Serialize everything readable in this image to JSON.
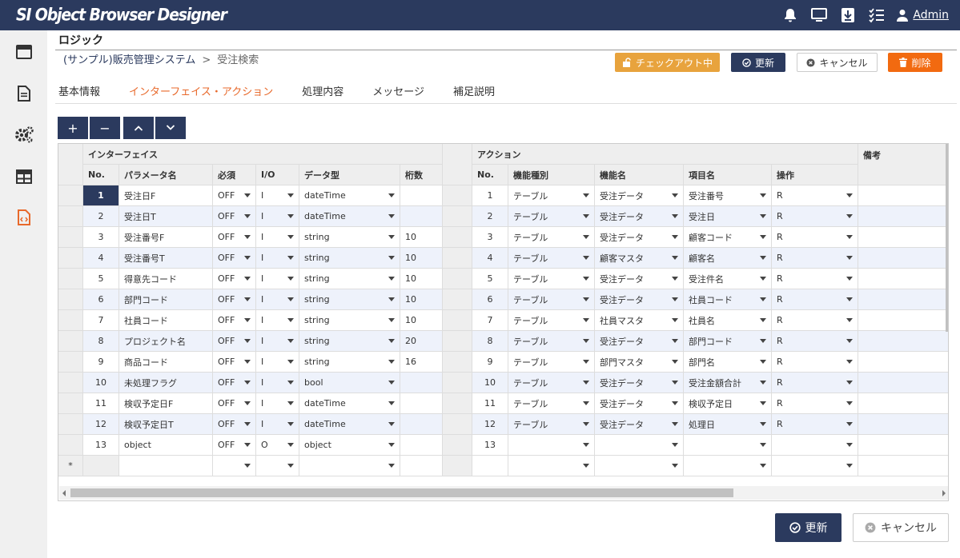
{
  "app": {
    "title": "SI Object Browser Designer"
  },
  "header": {
    "user_label": "Admin"
  },
  "page": {
    "title": "ロジック",
    "breadcrumb": {
      "system": "(サンプル)販売管理システム",
      "separator": ">",
      "current": "受注検索"
    }
  },
  "actions": {
    "checkout": "チェックアウト中",
    "update": "更新",
    "cancel": "キャンセル",
    "delete": "削除"
  },
  "tabs": [
    "基本情報",
    "インターフェイス・アクション",
    "処理内容",
    "メッセージ",
    "補足説明"
  ],
  "toolbar": {
    "add": "+",
    "remove": "−"
  },
  "grid": {
    "group_interface": "インターフェイス",
    "group_action": "アクション",
    "group_notes": "備考",
    "if_columns": [
      "No.",
      "パラメータ名",
      "必須",
      "I/O",
      "データ型",
      "桁数"
    ],
    "act_columns": [
      "No.",
      "機能種別",
      "機能名",
      "項目名",
      "操作"
    ],
    "new_row_marker": "*",
    "rows": [
      {
        "no": "1",
        "param": "受注日F",
        "req": "OFF",
        "io": "I",
        "type": "dateTime",
        "len": "",
        "ano": "1",
        "kind": "テーブル",
        "func": "受注データ",
        "item": "受注番号",
        "op": "R"
      },
      {
        "no": "2",
        "param": "受注日T",
        "req": "OFF",
        "io": "I",
        "type": "dateTime",
        "len": "",
        "ano": "2",
        "kind": "テーブル",
        "func": "受注データ",
        "item": "受注日",
        "op": "R"
      },
      {
        "no": "3",
        "param": "受注番号F",
        "req": "OFF",
        "io": "I",
        "type": "string",
        "len": "10",
        "ano": "3",
        "kind": "テーブル",
        "func": "受注データ",
        "item": "顧客コード",
        "op": "R"
      },
      {
        "no": "4",
        "param": "受注番号T",
        "req": "OFF",
        "io": "I",
        "type": "string",
        "len": "10",
        "ano": "4",
        "kind": "テーブル",
        "func": "顧客マスタ",
        "item": "顧客名",
        "op": "R"
      },
      {
        "no": "5",
        "param": "得意先コード",
        "req": "OFF",
        "io": "I",
        "type": "string",
        "len": "10",
        "ano": "5",
        "kind": "テーブル",
        "func": "受注データ",
        "item": "受注件名",
        "op": "R"
      },
      {
        "no": "6",
        "param": "部門コード",
        "req": "OFF",
        "io": "I",
        "type": "string",
        "len": "10",
        "ano": "6",
        "kind": "テーブル",
        "func": "受注データ",
        "item": "社員コード",
        "op": "R"
      },
      {
        "no": "7",
        "param": "社員コード",
        "req": "OFF",
        "io": "I",
        "type": "string",
        "len": "10",
        "ano": "7",
        "kind": "テーブル",
        "func": "社員マスタ",
        "item": "社員名",
        "op": "R"
      },
      {
        "no": "8",
        "param": "プロジェクト名",
        "req": "OFF",
        "io": "I",
        "type": "string",
        "len": "20",
        "ano": "8",
        "kind": "テーブル",
        "func": "受注データ",
        "item": "部門コード",
        "op": "R"
      },
      {
        "no": "9",
        "param": "商品コード",
        "req": "OFF",
        "io": "I",
        "type": "string",
        "len": "16",
        "ano": "9",
        "kind": "テーブル",
        "func": "部門マスタ",
        "item": "部門名",
        "op": "R"
      },
      {
        "no": "10",
        "param": "未処理フラグ",
        "req": "OFF",
        "io": "I",
        "type": "bool",
        "len": "",
        "ano": "10",
        "kind": "テーブル",
        "func": "受注データ",
        "item": "受注金額合計",
        "op": "R"
      },
      {
        "no": "11",
        "param": "検収予定日F",
        "req": "OFF",
        "io": "I",
        "type": "dateTime",
        "len": "",
        "ano": "11",
        "kind": "テーブル",
        "func": "受注データ",
        "item": "検収予定日",
        "op": "R"
      },
      {
        "no": "12",
        "param": "検収予定日T",
        "req": "OFF",
        "io": "I",
        "type": "dateTime",
        "len": "",
        "ano": "12",
        "kind": "テーブル",
        "func": "受注データ",
        "item": "処理日",
        "op": "R"
      },
      {
        "no": "13",
        "param": "object",
        "req": "OFF",
        "io": "O",
        "type": "object",
        "len": "",
        "ano": "13",
        "kind": "",
        "func": "",
        "item": "",
        "op": ""
      }
    ]
  },
  "footer": {
    "update": "更新",
    "cancel": "キャンセル"
  },
  "colors": {
    "navy": "#2b3a5e",
    "accent": "#e8692b",
    "checkout": "#e8a33d",
    "delete": "#f26a10",
    "row_alt": "#eef2fb"
  }
}
